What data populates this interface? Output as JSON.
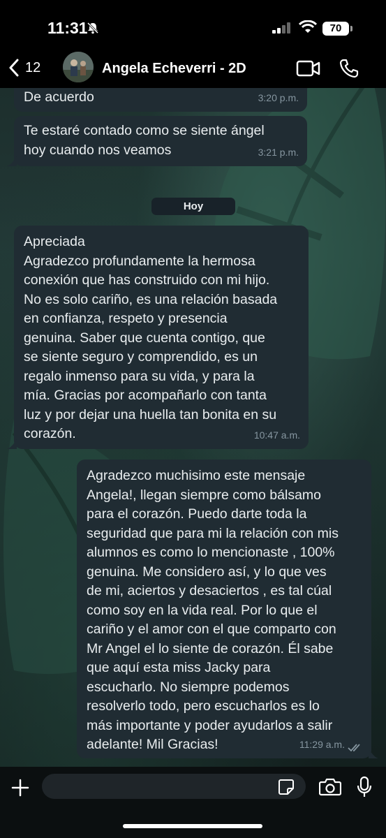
{
  "status_bar": {
    "time": "11:31",
    "battery": "70"
  },
  "header": {
    "back_count": "12",
    "contact_name": "Angela Echeverri - 2D"
  },
  "messages": [
    {
      "direction": "incoming",
      "text": "De acuerdo",
      "time": "3:20 p.m."
    },
    {
      "direction": "incoming",
      "text": "Te estaré contado como se siente ángel\nhoy cuando nos veamos",
      "time": "3:21 p.m."
    },
    {
      "direction": "incoming",
      "text": "Apreciada\nAgradezco profundamente la hermosa\nconexión que has construido con mi hijo.\nNo es solo cariño, es una relación basada\nen confianza, respeto y presencia\ngenuina. Saber que cuenta contigo, que\nse siente seguro y comprendido, es un\nregalo inmenso para su vida, y para la\nmía. Gracias por acompañarlo con tanta\nluz y por dejar una huella tan bonita en su\ncorazón.",
      "time": "10:47 a.m."
    },
    {
      "direction": "outgoing",
      "text": "Agradezco muchisimo este mensaje\nAngela!, llegan siempre como bálsamo\npara el corazón. Puedo darte toda la\nseguridad que para mi la relación con mis\nalumnos es como lo mencionaste , 100%\ngenuina. Me considero así, y lo que ves\nde mi, aciertos y desaciertos , es tal cúal\ncomo soy en la vida real. Por lo que el\ncariño y el amor con el que comparto con\nMr Angel el lo siente de corazón. Él sabe\nque aquí esta miss Jacky para\nescucharlo. No siempre podemos\nresolverlo todo, pero escucharlos es lo\nmás importante y poder ayudarlos a salir\nadelante! Mil Gracias!",
      "time": "11:29 a.m."
    }
  ],
  "date_separator": "Hoy",
  "input": {
    "placeholder": ""
  },
  "colors": {
    "bubble": "#202c33",
    "read_ticks": "#8696a0",
    "bar_background": "#000000"
  }
}
